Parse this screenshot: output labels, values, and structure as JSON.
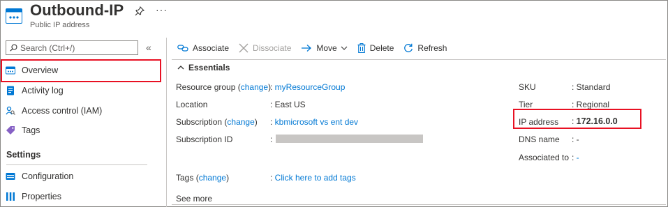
{
  "header": {
    "title": "Outbound-IP",
    "subtitle": "Public IP address",
    "more": "···"
  },
  "sidebar": {
    "search_placeholder": "Search (Ctrl+/)",
    "collapse": "«",
    "items": [
      {
        "label": "Overview",
        "icon": "overview-icon"
      },
      {
        "label": "Activity log",
        "icon": "activity-log-icon"
      },
      {
        "label": "Access control (IAM)",
        "icon": "iam-icon"
      },
      {
        "label": "Tags",
        "icon": "tag-icon"
      }
    ],
    "settings_header": "Settings",
    "settings_items": [
      {
        "label": "Configuration",
        "icon": "configuration-icon"
      },
      {
        "label": "Properties",
        "icon": "properties-icon"
      }
    ]
  },
  "toolbar": {
    "associate": "Associate",
    "dissociate": "Dissociate",
    "move": "Move",
    "delete": "Delete",
    "refresh": "Refresh"
  },
  "essentials": {
    "header": "Essentials",
    "left": {
      "resource_group_label": "Resource group",
      "resource_group_change": "change",
      "resource_group_value": "myResourceGroup",
      "location_label": "Location",
      "location_value": "East US",
      "subscription_label": "Subscription",
      "subscription_change": "change",
      "subscription_value": "kbmicrosoft vs ent dev",
      "subscription_id_label": "Subscription ID",
      "tags_label": "Tags",
      "tags_change": "change",
      "tags_value": "Click here to add tags",
      "see_more": "See more"
    },
    "right": {
      "sku_label": "SKU",
      "sku_value": "Standard",
      "tier_label": "Tier",
      "tier_value": "Regional",
      "ip_label": "IP address",
      "ip_value": "172.16.0.0",
      "dns_label": "DNS name",
      "dns_value": "-",
      "assoc_label": "Associated to",
      "assoc_value": "-"
    }
  },
  "colors": {
    "accent": "#0078d4",
    "highlight": "#e81123",
    "text": "#323130",
    "disabled": "#a19f9d"
  }
}
